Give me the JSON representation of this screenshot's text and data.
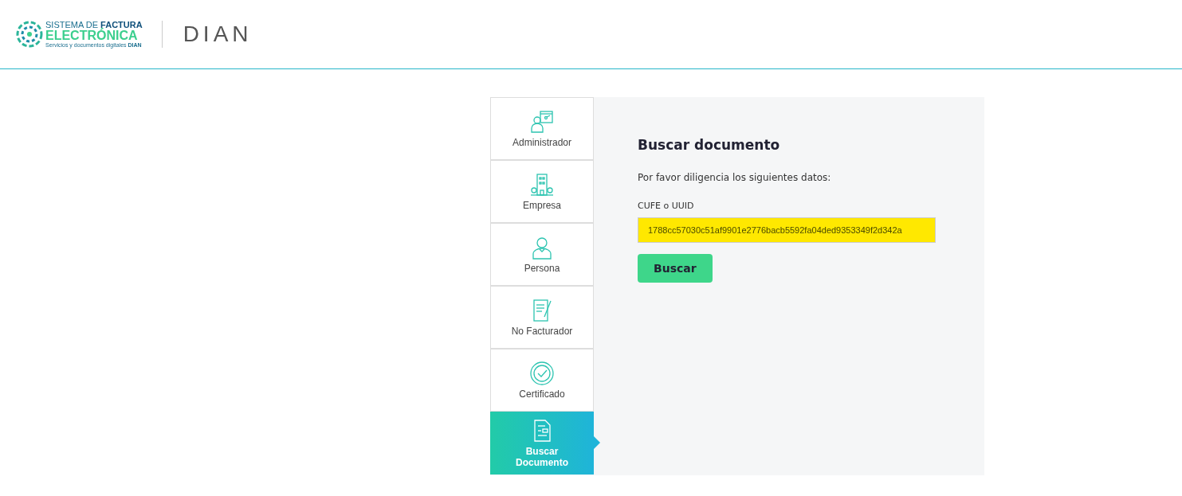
{
  "header": {
    "logo_line_1": "SISTEMA DE **FACTURA**",
    "logo_line_2": "ELECTRÓNICA",
    "logo_line_3": "Servicios y documentos digitales **DIAN**",
    "brand": "DIAN"
  },
  "sidebar": {
    "items": [
      {
        "label": "Administrador",
        "kind": "admin",
        "selected": false
      },
      {
        "label": "Empresa",
        "kind": "building",
        "selected": false
      },
      {
        "label": "Persona",
        "kind": "person",
        "selected": false
      },
      {
        "label": "No Facturador",
        "kind": "document-pen",
        "selected": false
      },
      {
        "label": "Certificado",
        "kind": "certificate",
        "selected": false
      },
      {
        "label": "Buscar Documento",
        "kind": "search-document",
        "selected": true
      }
    ]
  },
  "form": {
    "title": "Buscar documento",
    "instructions": "Por favor diligencia los siguientes datos:",
    "field_label": "CUFE o UUID",
    "field_value": "1788cc57030c51af9901e2776bacb5592fa04ded9353349f2d342a",
    "highlighted": true,
    "button": "Buscar"
  }
}
